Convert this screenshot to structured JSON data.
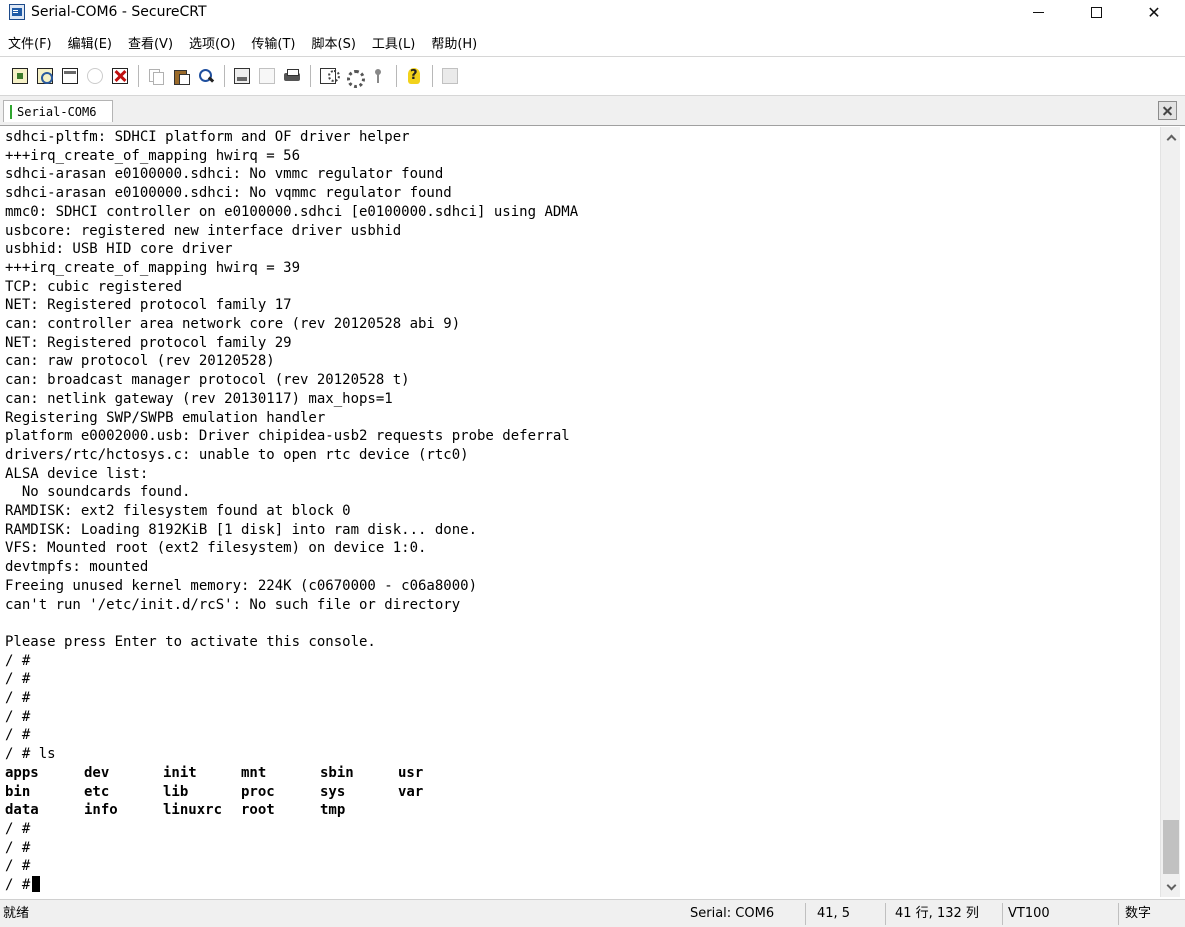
{
  "window": {
    "title": "Serial-COM6 - SecureCRT"
  },
  "menu": [
    "文件(F)",
    "编辑(E)",
    "查看(V)",
    "选项(O)",
    "传输(T)",
    "脚本(S)",
    "工具(L)",
    "帮助(H)"
  ],
  "toolbar": {
    "icons": [
      "connect-icon",
      "quick-connect-icon",
      "connect-in-tab-icon",
      "reconnect-icon",
      "disconnect-icon",
      "copy-icon",
      "paste-icon",
      "find-icon",
      "print-setup-icon",
      "print-selection-icon",
      "print-icon",
      "session-options-icon",
      "global-options-icon",
      "keymap-icon",
      "help-icon",
      "keypad-icon"
    ]
  },
  "tabs": [
    {
      "label": "Serial-COM6",
      "status_color": "#2fa52f"
    }
  ],
  "terminal": {
    "lines": [
      "sdhci-pltfm: SDHCI platform and OF driver helper",
      "+++irq_create_of_mapping hwirq = 56",
      "sdhci-arasan e0100000.sdhci: No vmmc regulator found",
      "sdhci-arasan e0100000.sdhci: No vqmmc regulator found",
      "mmc0: SDHCI controller on e0100000.sdhci [e0100000.sdhci] using ADMA",
      "usbcore: registered new interface driver usbhid",
      "usbhid: USB HID core driver",
      "+++irq_create_of_mapping hwirq = 39",
      "TCP: cubic registered",
      "NET: Registered protocol family 17",
      "can: controller area network core (rev 20120528 abi 9)",
      "NET: Registered protocol family 29",
      "can: raw protocol (rev 20120528)",
      "can: broadcast manager protocol (rev 20120528 t)",
      "can: netlink gateway (rev 20130117) max_hops=1",
      "Registering SWP/SWPB emulation handler",
      "platform e0002000.usb: Driver chipidea-usb2 requests probe deferral",
      "drivers/rtc/hctosys.c: unable to open rtc device (rtc0)",
      "ALSA device list:",
      "  No soundcards found.",
      "RAMDISK: ext2 filesystem found at block 0",
      "RAMDISK: Loading 8192KiB [1 disk] into ram disk... done.",
      "VFS: Mounted root (ext2 filesystem) on device 1:0.",
      "devtmpfs: mounted",
      "Freeing unused kernel memory: 224K (c0670000 - c06a8000)",
      "can't run '/etc/init.d/rcS': No such file or directory",
      "",
      "Please press Enter to activate this console.",
      "/ #",
      "/ #",
      "/ #",
      "/ #",
      "/ #",
      "/ # ls"
    ],
    "ls_output": [
      [
        "apps",
        "dev",
        "init",
        "mnt",
        "sbin",
        "usr"
      ],
      [
        "bin",
        "etc",
        "lib",
        "proc",
        "sys",
        "var"
      ],
      [
        "data",
        "info",
        "linuxrc",
        "root",
        "tmp"
      ]
    ],
    "trailing_lines": [
      "/ #",
      "/ #",
      "/ #"
    ],
    "prompt": "/ #"
  },
  "statusbar": {
    "status": "就绪",
    "connection": "Serial: COM6",
    "cursor_pos": "41,  5",
    "size": "41 行, 132 列",
    "emulation": "VT100",
    "numlock": "数字"
  }
}
